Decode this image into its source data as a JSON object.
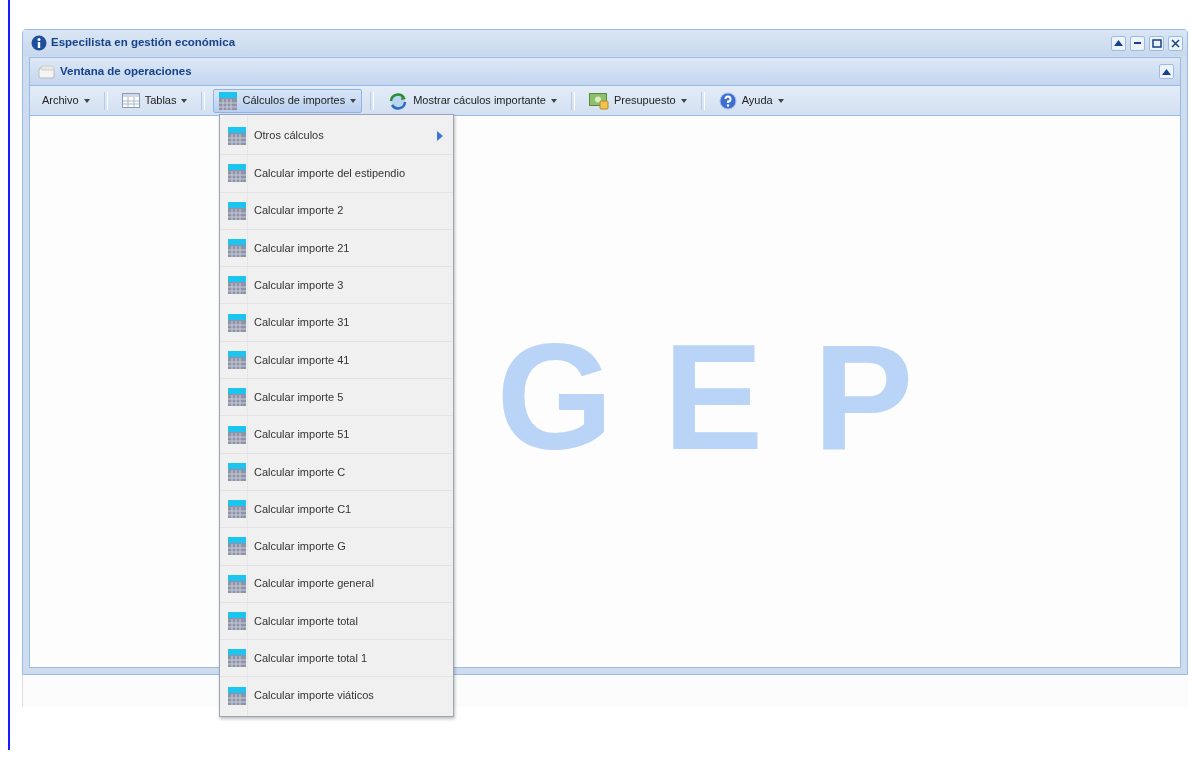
{
  "window": {
    "title": "Especilista en gestión económica"
  },
  "panel": {
    "title": "Ventana de operaciones"
  },
  "toolbar": [
    {
      "label": "Archivo",
      "selected": false
    },
    {
      "label": "Tablas",
      "selected": false
    },
    {
      "label": "Cálculos de importes",
      "selected": true
    },
    {
      "label": "Mostrar cáculos importante",
      "selected": false
    },
    {
      "label": "Presupuesto",
      "selected": false
    },
    {
      "label": "Ayuda",
      "selected": false
    }
  ],
  "menu": [
    {
      "label": "Otros cálculos",
      "submenu": true
    },
    {
      "label": "Calcular importe del estipendio",
      "submenu": false
    },
    {
      "label": "Calcular importe 2",
      "submenu": false
    },
    {
      "label": "Calcular importe 21",
      "submenu": false
    },
    {
      "label": "Calcular importe 3",
      "submenu": false
    },
    {
      "label": "Calcular importe 31",
      "submenu": false
    },
    {
      "label": "Calcular importe 41",
      "submenu": false
    },
    {
      "label": "Calcular importe 5",
      "submenu": false
    },
    {
      "label": "Calcular importe 51",
      "submenu": false
    },
    {
      "label": "Calcular importe C",
      "submenu": false
    },
    {
      "label": "Calcular importe C1",
      "submenu": false
    },
    {
      "label": "Calcular importe G",
      "submenu": false
    },
    {
      "label": "Calcular importe general",
      "submenu": false
    },
    {
      "label": "Calcular importe total",
      "submenu": false
    },
    {
      "label": "Calcular importe total 1",
      "submenu": false
    },
    {
      "label": "Calcular importe viáticos",
      "submenu": false
    }
  ],
  "background_logo": "GEP"
}
